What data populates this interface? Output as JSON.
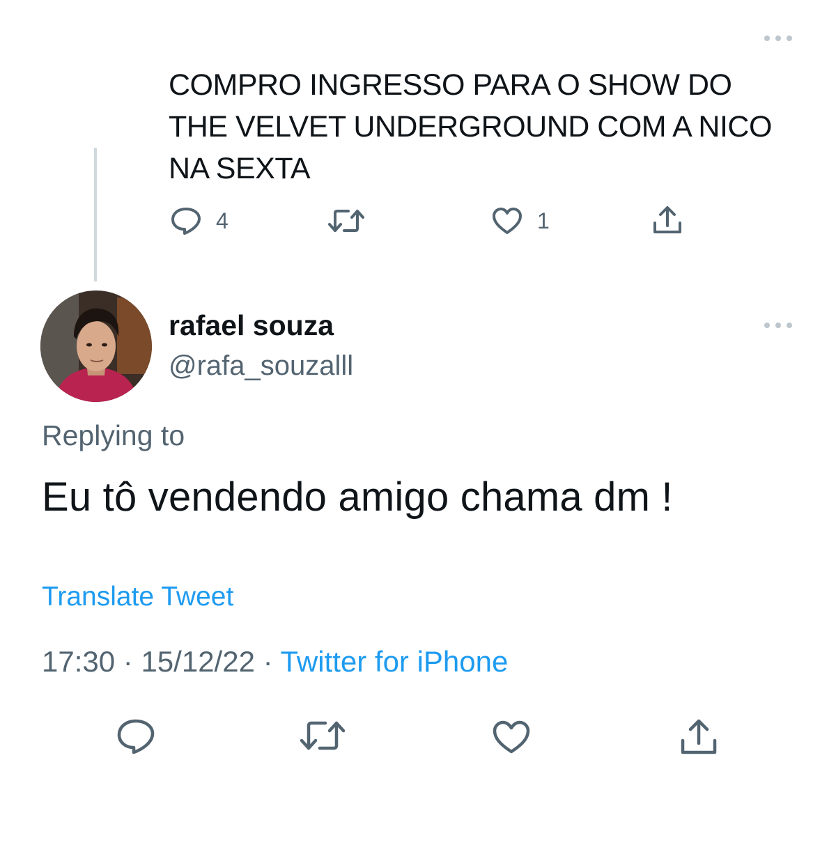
{
  "parent_tweet": {
    "text": "COMPRO INGRESSO PARA O SHOW DO THE VELVET UNDERGROUND COM A NICO NA SEXTA",
    "actions": {
      "reply": {
        "icon": "reply-icon",
        "count": "4"
      },
      "retweet": {
        "icon": "retweet-icon",
        "count": ""
      },
      "like": {
        "icon": "heart-icon",
        "count": "1"
      },
      "share": {
        "icon": "share-icon",
        "count": ""
      }
    },
    "more_icon": "more-options-icon"
  },
  "reply_tweet": {
    "display_name": "rafael souza",
    "handle": "@rafa_souzalll",
    "replying_to": "Replying to",
    "text": "Eu tô vendendo amigo chama dm !",
    "translate_label": "Translate Tweet",
    "time": "17:30",
    "separator": "·",
    "date": "15/12/22",
    "source": "Twitter for iPhone",
    "actions": [
      "reply-icon",
      "retweet-icon",
      "heart-icon",
      "share-icon"
    ],
    "more_icon": "more-options-icon"
  },
  "colors": {
    "text": "#0f1419",
    "secondary": "#536471",
    "accent": "#1d9bf0",
    "thread_line": "#cfd9de"
  }
}
